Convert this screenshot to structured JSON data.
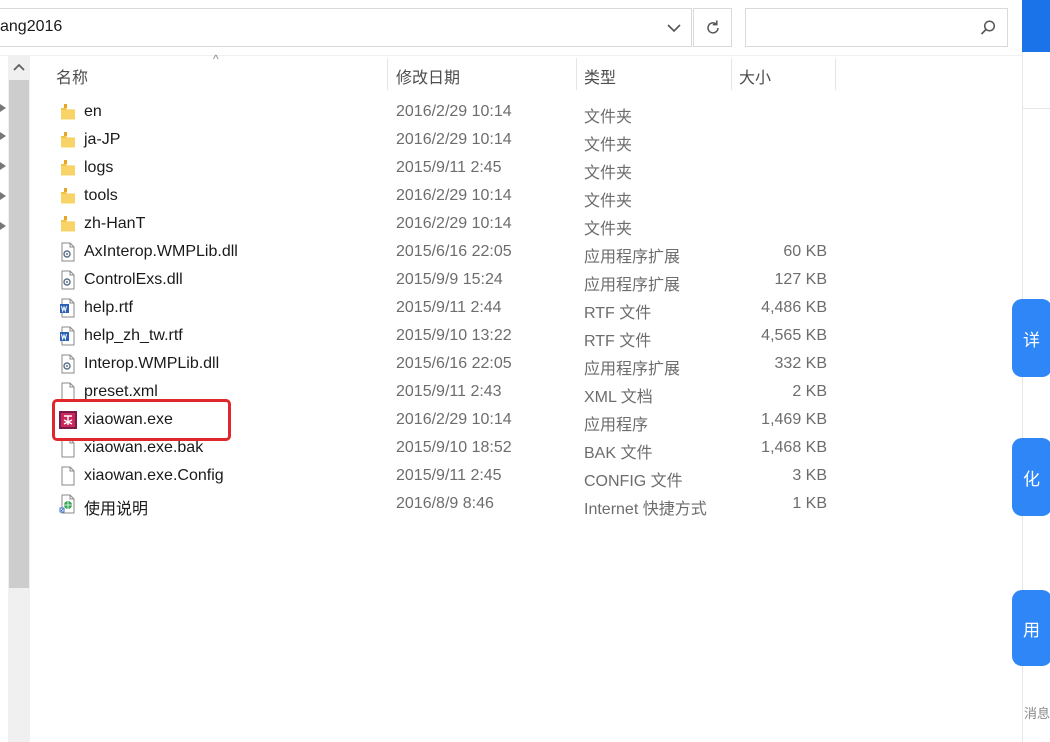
{
  "address": {
    "path": "ang2016"
  },
  "search": {
    "placeholder": ""
  },
  "columns": {
    "name": "名称",
    "date": "修改日期",
    "type": "类型",
    "size": "大小"
  },
  "files": [
    {
      "name": "en",
      "date": "2016/2/29 10:14",
      "type": "文件夹",
      "size": "",
      "icon": "folder-icon"
    },
    {
      "name": "ja-JP",
      "date": "2016/2/29 10:14",
      "type": "文件夹",
      "size": "",
      "icon": "folder-icon"
    },
    {
      "name": "logs",
      "date": "2015/9/11 2:45",
      "type": "文件夹",
      "size": "",
      "icon": "folder-icon"
    },
    {
      "name": "tools",
      "date": "2016/2/29 10:14",
      "type": "文件夹",
      "size": "",
      "icon": "folder-icon"
    },
    {
      "name": "zh-HanT",
      "date": "2016/2/29 10:14",
      "type": "文件夹",
      "size": "",
      "icon": "folder-icon"
    },
    {
      "name": "AxInterop.WMPLib.dll",
      "date": "2015/6/16 22:05",
      "type": "应用程序扩展",
      "size": "60 KB",
      "icon": "dll-file-icon"
    },
    {
      "name": "ControlExs.dll",
      "date": "2015/9/9 15:24",
      "type": "应用程序扩展",
      "size": "127 KB",
      "icon": "dll-file-icon"
    },
    {
      "name": "help.rtf",
      "date": "2015/9/11 2:44",
      "type": "RTF 文件",
      "size": "4,486 KB",
      "icon": "rtf-file-icon"
    },
    {
      "name": "help_zh_tw.rtf",
      "date": "2015/9/10 13:22",
      "type": "RTF 文件",
      "size": "4,565 KB",
      "icon": "rtf-file-icon"
    },
    {
      "name": "Interop.WMPLib.dll",
      "date": "2015/6/16 22:05",
      "type": "应用程序扩展",
      "size": "332 KB",
      "icon": "dll-file-icon"
    },
    {
      "name": "preset.xml",
      "date": "2015/9/11 2:43",
      "type": "XML 文档",
      "size": "2 KB",
      "icon": "blank-file-icon"
    },
    {
      "name": "xiaowan.exe",
      "date": "2016/2/29 10:14",
      "type": "应用程序",
      "size": "1,469 KB",
      "icon": "app-exe-icon"
    },
    {
      "name": "xiaowan.exe.bak",
      "date": "2015/9/10 18:52",
      "type": "BAK 文件",
      "size": "1,468 KB",
      "icon": "blank-file-icon"
    },
    {
      "name": "xiaowan.exe.Config",
      "date": "2015/9/11 2:45",
      "type": "CONFIG 文件",
      "size": "3 KB",
      "icon": "blank-file-icon"
    },
    {
      "name": "使用说明",
      "date": "2016/8/9 8:46",
      "type": "Internet 快捷方式",
      "size": "1 KB",
      "icon": "internet-shortcut-icon"
    }
  ],
  "right_panel": {
    "btn1": "详",
    "btn2": "化",
    "btn3": "用",
    "msg": "消息"
  },
  "colors": {
    "highlight": "#e0282c",
    "accent": "#2f86f6",
    "folder": "#f5c542"
  }
}
